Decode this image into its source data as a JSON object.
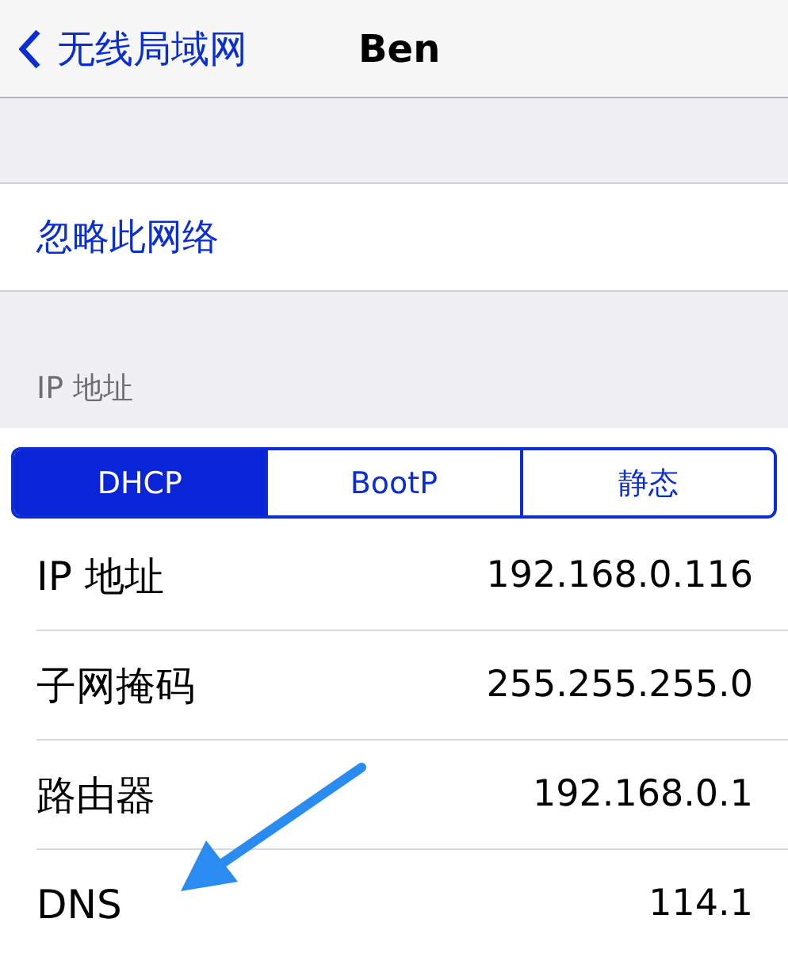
{
  "nav": {
    "back": "无线局域网",
    "title": "Ben"
  },
  "forget": "忽略此网络",
  "section_header": "IP 地址",
  "segments": [
    {
      "label": "DHCP",
      "selected": true
    },
    {
      "label": "BootP",
      "selected": false
    },
    {
      "label": "静态",
      "selected": false
    }
  ],
  "rows": [
    {
      "label": "IP 地址",
      "value": "192.168.0.116"
    },
    {
      "label": "子网掩码",
      "value": "255.255.255.0"
    },
    {
      "label": "路由器",
      "value": "192.168.0.1"
    },
    {
      "label": "DNS",
      "value": "114.1"
    }
  ]
}
